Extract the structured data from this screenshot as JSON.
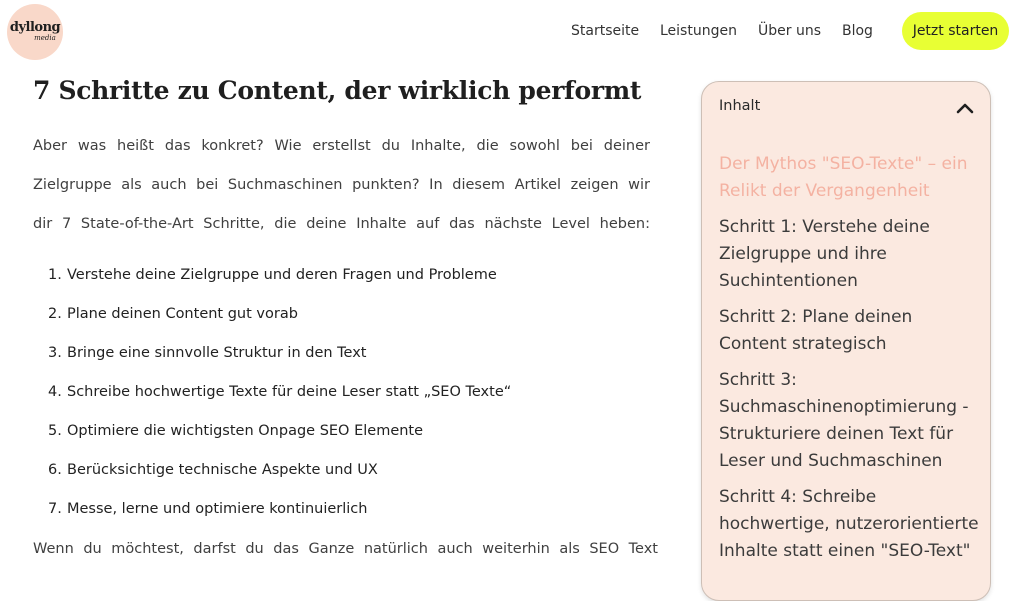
{
  "header": {
    "logo_main": "dyllong",
    "logo_sub": "media",
    "nav": [
      "Startseite",
      "Leistungen",
      "Über uns",
      "Blog"
    ],
    "cta_label": "Jetzt starten"
  },
  "article": {
    "title": "7 Schritte zu Content, der wirklich performt",
    "intro_lines": [
      "Aber was heißt das konkret? Wie erstellst du Inhalte, die sowohl bei deiner",
      "Zielgruppe als auch bei Suchmaschinen punkten? In diesem Artikel zeigen wir",
      "dir 7 State-of-the-Art Schritte, die deine Inhalte auf das nächste Level heben:"
    ],
    "steps": [
      {
        "num": "1.",
        "text": "Verstehe deine Zielgruppe und deren Fragen und Probleme"
      },
      {
        "num": "2.",
        "text": "Plane deinen Content gut vorab"
      },
      {
        "num": "3.",
        "text": "Bringe eine sinnvolle Struktur in den Text"
      },
      {
        "num": "4.",
        "text": "Schreibe hochwertige Texte für deine Leser statt „SEO Texte“"
      },
      {
        "num": "5.",
        "text": "Optimiere die wichtigsten Onpage SEO Elemente"
      },
      {
        "num": "6.",
        "text": "Berücksichtige technische Aspekte und UX"
      },
      {
        "num": "7.",
        "text": "Messe, lerne und optimiere kontinuierlich"
      }
    ],
    "outro_line": "Wenn du möchtest, darfst du das Ganze natürlich auch weiterhin als SEO Text"
  },
  "toc": {
    "heading": "Inhalt",
    "items": [
      "Der Mythos \"SEO-Texte\" – ein Relikt der Vergangenheit",
      "Schritt 1: Verstehe deine Zielgruppe und ihre Suchintentionen",
      "Schritt 2: Plane deinen Content strategisch",
      "Schritt 3: Suchmaschinenoptimierung - Strukturiere deinen Text für Leser und Suchmaschinen",
      "Schritt 4: Schreibe hochwertige, nutzerorientierte Inhalte statt einen \"SEO-Text\""
    ],
    "active_item_color": "#f4b2a2",
    "background_color": "#fbe9e0"
  },
  "colors": {
    "accent_cta": "#e8ff34",
    "logo_bg": "#f9d8c9"
  },
  "icons": {
    "toc_toggle": "chevron-up-icon"
  }
}
